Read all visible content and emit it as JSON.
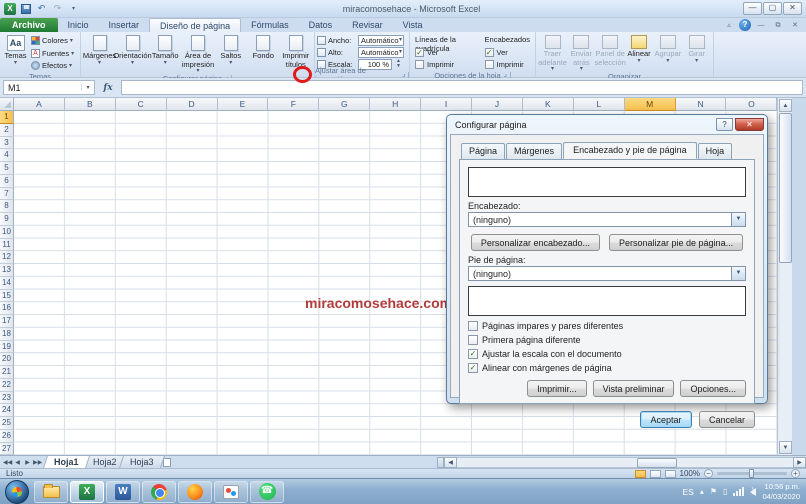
{
  "colors": {
    "selected_header": "#F8CD71",
    "watermark_text": "#B23B3B",
    "annotation_circle": "#E01B1C",
    "archivo_tab_green": "#2E9B44"
  },
  "window": {
    "title": "miracomosehace - Microsoft Excel"
  },
  "ribbon": {
    "tabs": [
      "Archivo",
      "Inicio",
      "Insertar",
      "Diseño de página",
      "Fórmulas",
      "Datos",
      "Revisar",
      "Vista"
    ],
    "active_tab": "Diseño de página",
    "groups": {
      "temas": {
        "label": "Temas",
        "big_button": "Temas",
        "items": [
          "Colores",
          "Fuentes",
          "Efectos"
        ]
      },
      "configurar_pagina": {
        "label": "Configurar página",
        "buttons": [
          {
            "label": "Márgenes",
            "arrow": true
          },
          {
            "label": "Orientación",
            "arrow": true
          },
          {
            "label": "Tamaño",
            "arrow": true
          },
          {
            "label": "Área de impresión",
            "arrow": true
          },
          {
            "label": "Saltos",
            "arrow": true
          },
          {
            "label": "Fondo",
            "arrow": false
          },
          {
            "label": "Imprimir títulos",
            "arrow": false
          }
        ]
      },
      "ajustar": {
        "label": "Ajustar área de impresión",
        "fields": [
          {
            "label": "Ancho:",
            "value": "Automático",
            "kind": "combo"
          },
          {
            "label": "Alto:",
            "value": "Automático",
            "kind": "combo"
          },
          {
            "label": "Escala:",
            "value": "100 %",
            "kind": "spin"
          }
        ]
      },
      "opciones_hoja": {
        "label": "Opciones de la hoja",
        "columns": [
          {
            "title": "Líneas de la cuadrícula",
            "options": [
              {
                "label": "Ver",
                "checked": true
              },
              {
                "label": "Imprimir",
                "checked": false
              }
            ]
          },
          {
            "title": "Encabezados",
            "options": [
              {
                "label": "Ver",
                "checked": true
              },
              {
                "label": "Imprimir",
                "checked": false
              }
            ]
          }
        ]
      },
      "organizar": {
        "label": "Organizar",
        "buttons": [
          {
            "label": "Traer adelante",
            "enabled": false,
            "arrow": true
          },
          {
            "label": "Enviar atrás",
            "enabled": false,
            "arrow": true
          },
          {
            "label": "Panel de selección",
            "enabled": false,
            "arrow": false
          },
          {
            "label": "Alinear",
            "enabled": true,
            "arrow": true
          },
          {
            "label": "Agrupar",
            "enabled": false,
            "arrow": true
          },
          {
            "label": "Girar",
            "enabled": false,
            "arrow": true
          }
        ]
      }
    }
  },
  "formula_bar": {
    "name_box": "M1",
    "fx": "fx"
  },
  "grid": {
    "columns": [
      "A",
      "B",
      "C",
      "D",
      "E",
      "F",
      "G",
      "H",
      "I",
      "J",
      "K",
      "L",
      "M",
      "N",
      "O"
    ],
    "selected_column": "M",
    "rows": [
      1,
      2,
      3,
      4,
      5,
      6,
      7,
      8,
      9,
      10,
      11,
      12,
      13,
      14,
      15,
      16,
      17,
      18,
      19,
      20,
      21,
      22,
      23,
      24,
      25,
      26,
      27
    ],
    "selected_row": 1,
    "watermark": "miracomosehace.com"
  },
  "dialog": {
    "title": "Configurar página",
    "help_button": "?",
    "tabs": [
      "Página",
      "Márgenes",
      "Encabezado y pie de página",
      "Hoja"
    ],
    "active_tab": "Encabezado y pie de página",
    "header_label": "Encabezado:",
    "header_value": "(ninguno)",
    "customize_header_button": "Personalizar encabezado...",
    "customize_footer_button": "Personalizar pie de página...",
    "footer_label": "Pie de página:",
    "footer_value": "(ninguno)",
    "checkboxes": [
      {
        "label": "Páginas impares y pares diferentes",
        "checked": false
      },
      {
        "label": "Primera página diferente",
        "checked": false
      },
      {
        "label": "Ajustar la escala con el documento",
        "checked": true
      },
      {
        "label": "Alinear con márgenes de página",
        "checked": true
      }
    ],
    "buttons": {
      "print": "Imprimir...",
      "preview": "Vista preliminar",
      "options": "Opciones...",
      "ok": "Aceptar",
      "cancel": "Cancelar"
    }
  },
  "sheet_tabs": {
    "tabs": [
      "Hoja1",
      "Hoja2",
      "Hoja3"
    ],
    "active": "Hoja1"
  },
  "status_bar": {
    "mode": "Listo",
    "zoom": "100%"
  },
  "taskbar": {
    "icons": [
      "start",
      "explorer",
      "excel",
      "word",
      "chrome",
      "firefox",
      "paint",
      "whatsapp"
    ],
    "active_icon": "excel"
  },
  "tray": {
    "language": "ES",
    "time": "10:56 p.m.",
    "date": "04/03/2020"
  }
}
